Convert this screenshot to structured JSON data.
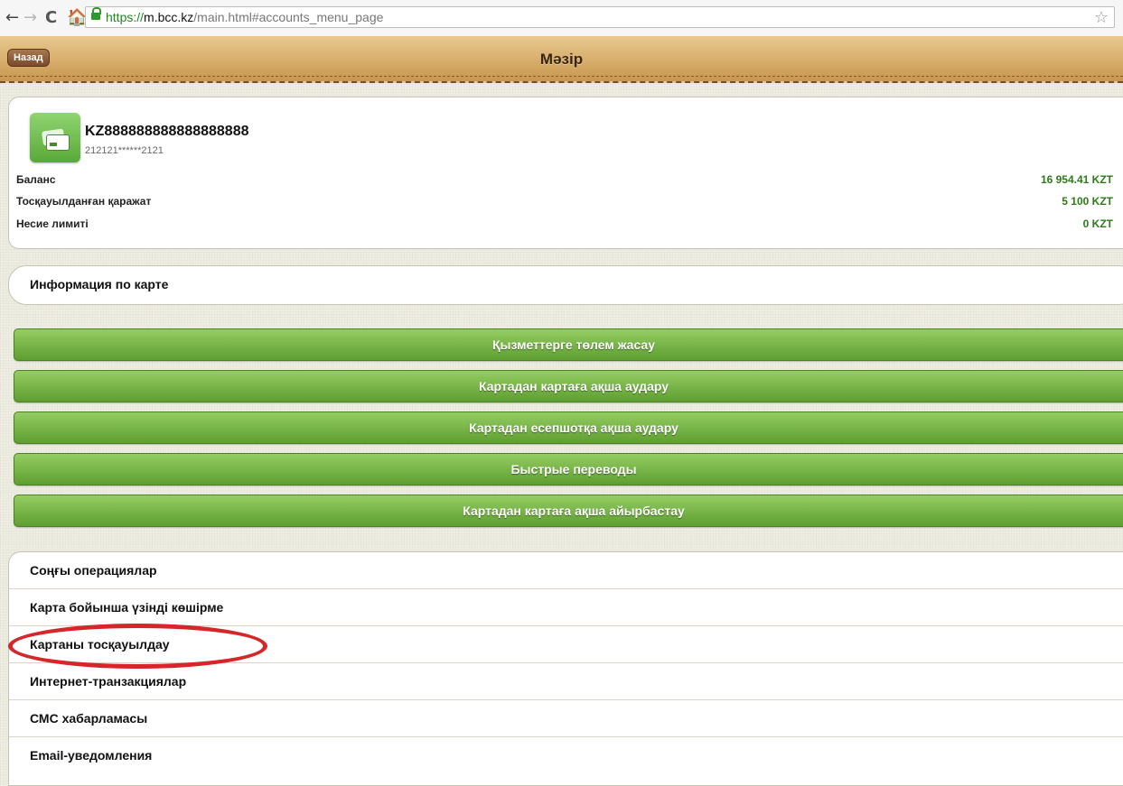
{
  "browser": {
    "url_scheme": "https://",
    "url_host": "m.bcc.kz",
    "url_path": "/main.html#accounts_menu_page",
    "back_glyph": "←",
    "forward_glyph": "→",
    "reload_glyph": "C",
    "home_glyph": "🏠",
    "star_glyph": "☆"
  },
  "header": {
    "back_label": "Назад",
    "title": "Мәзір"
  },
  "account": {
    "number": "KZ888888888888888888",
    "masked_pan": "212121******2121",
    "rows": [
      {
        "label": "Баланс",
        "value": "16 954.41 KZT"
      },
      {
        "label": "Тосқауылданған қаражат",
        "value": "5 100 KZT"
      },
      {
        "label": "Несие лимиті",
        "value": "0 KZT"
      }
    ]
  },
  "card_info_label": "Информация по карте",
  "actions": [
    "Қызметтерге төлем жасау",
    "Картадан картаға ақша аудару",
    "Картадан есепшотқа ақша аудару",
    "Быстрые переводы",
    "Картадан картаға ақша айырбастау"
  ],
  "menu": [
    "Соңғы операциялар",
    "Карта бойынша үзінді көшірме",
    "Картаны тосқауылдау",
    "Интернет-транзакциялар",
    "СМС хабарламасы",
    "Email-уведомления"
  ],
  "icons": {
    "card_icon": "card-icon",
    "lock_icon": "lock-icon",
    "star_icon": "star-icon"
  },
  "colors": {
    "accent_green": "#6aab3c",
    "value_green": "#2e7a1a",
    "header_brown": "#c8974f",
    "highlight_red": "#d6262a"
  }
}
